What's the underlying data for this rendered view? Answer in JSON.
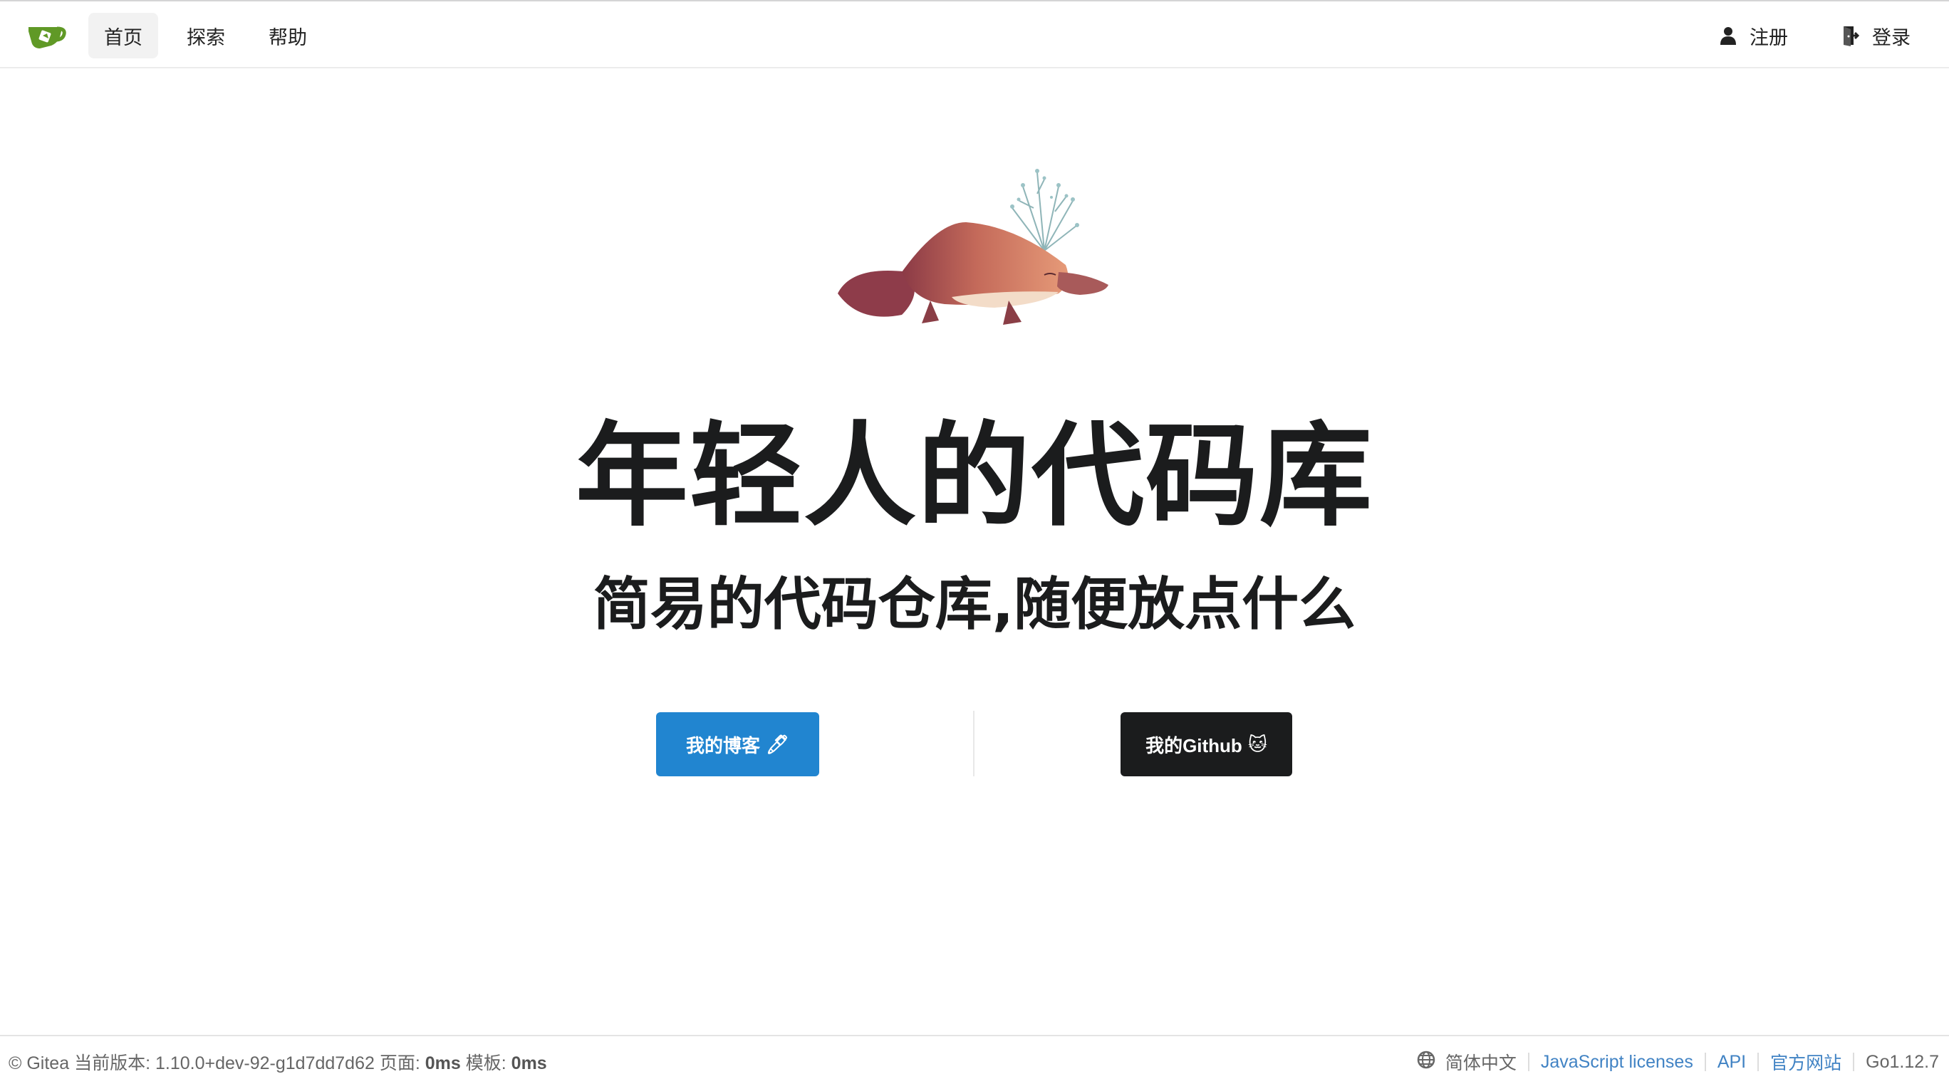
{
  "nav": {
    "home": "首页",
    "explore": "探索",
    "help": "帮助",
    "register": "注册",
    "login": "登录"
  },
  "hero": {
    "title": "年轻人的代码库",
    "subtitle": "简易的代码仓库,随便放点什么"
  },
  "buttons": {
    "blog": "我的博客",
    "blog_emoji": "🖊",
    "github": "我的Github",
    "github_emoji": "🐱"
  },
  "footer": {
    "copyright": "© Gitea",
    "version_label": "当前版本:",
    "version": "1.10.0+dev-92-g1d7dd7d62",
    "page_label": "页面:",
    "page_time": "0ms",
    "template_label": "模板:",
    "template_time": "0ms",
    "language": "简体中文",
    "js_licenses": "JavaScript licenses",
    "api": "API",
    "official_site": "官方网站",
    "go_version": "Go1.12.7"
  },
  "icons": {
    "logo": "gitea-teacup-logo",
    "register": "user-icon",
    "login": "sign-in-icon",
    "language": "globe-icon"
  },
  "colors": {
    "primary": "#2185d0",
    "dark": "#1b1c1d",
    "logo_green": "#609926",
    "link": "#4183c4"
  }
}
